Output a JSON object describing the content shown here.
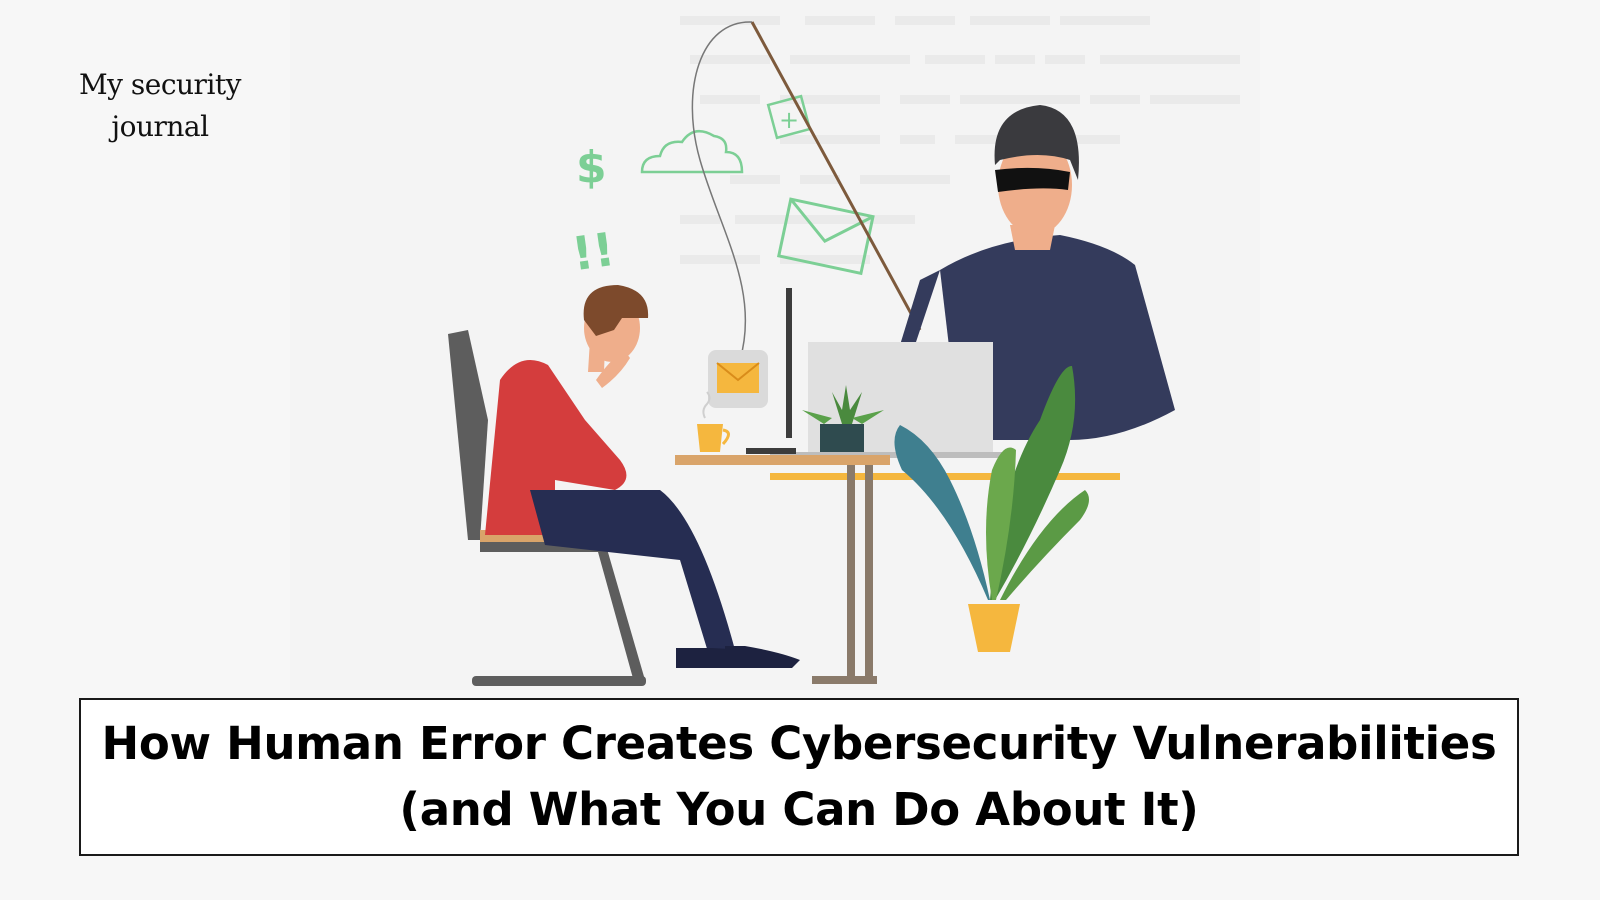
{
  "brand": {
    "line1": "My security",
    "line2": "journal"
  },
  "title": {
    "line1": "How Human Error Creates Cybersecurity Vulnerabilities",
    "line2": "(and What You Can Do About It)"
  },
  "illustration": {
    "symbols": {
      "dollar": "$",
      "exclamation": "!!",
      "plus": "+"
    },
    "colors": {
      "accent_green": "#7ccf95",
      "shirt_red": "#d43d3d",
      "hacker_navy": "#343b5c",
      "desk_wood": "#d9a46a",
      "envelope_yellow": "#f5b73e"
    }
  }
}
